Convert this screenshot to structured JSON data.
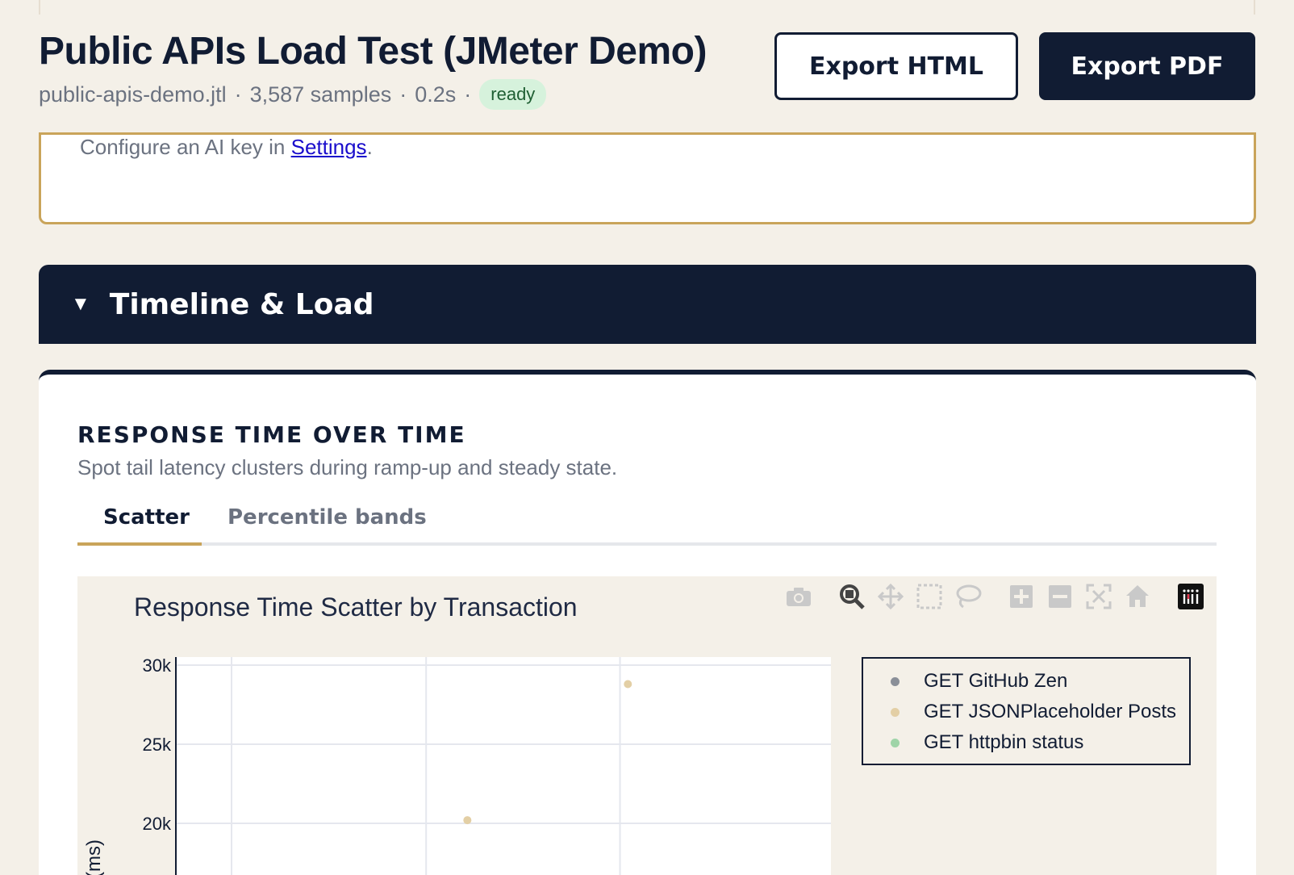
{
  "header": {
    "title": "Public APIs Load Test (JMeter Demo)",
    "file": "public-apis-demo.jtl",
    "samples": "3,587 samples",
    "duration": "0.2s",
    "separator": "·",
    "status": "ready",
    "export_html_label": "Export HTML",
    "export_pdf_label": "Export PDF"
  },
  "ai_notice": {
    "prefix": "Configure an AI key in ",
    "link_label": "Settings",
    "suffix": "."
  },
  "section": {
    "caret": "▼",
    "title": "Timeline & Load"
  },
  "card": {
    "title": "RESPONSE TIME OVER TIME",
    "subtitle": "Spot tail latency clusters during ramp-up and steady state.",
    "tabs": [
      {
        "label": "Scatter",
        "active": true
      },
      {
        "label": "Percentile bands",
        "active": false
      }
    ]
  },
  "modebar": {
    "icons": [
      "camera-icon",
      "zoom-icon",
      "pan-icon",
      "box-select-icon",
      "lasso-icon",
      "zoom-in-icon",
      "zoom-out-icon",
      "autoscale-icon",
      "reset-axes-icon",
      "plotly-logo-icon"
    ]
  },
  "chart_data": {
    "type": "scatter",
    "title": "Response Time Scatter by Transaction",
    "ylabel": "(ms)",
    "y_ticks": [
      "30k",
      "25k",
      "20k"
    ],
    "ylim_visible": [
      18000,
      31000
    ],
    "grid": true,
    "legend_position": "top-right",
    "series": [
      {
        "name": "GET GitHub Zen",
        "color": "#8a8f98",
        "points": []
      },
      {
        "name": "GET JSONPlaceholder Posts",
        "color": "#e3cfa5",
        "points": [
          {
            "x_frac": 0.69,
            "y": 28800
          },
          {
            "x_frac": 0.445,
            "y": 20200
          }
        ]
      },
      {
        "name": "GET httpbin status",
        "color": "#9fd4a8",
        "points": []
      }
    ]
  }
}
